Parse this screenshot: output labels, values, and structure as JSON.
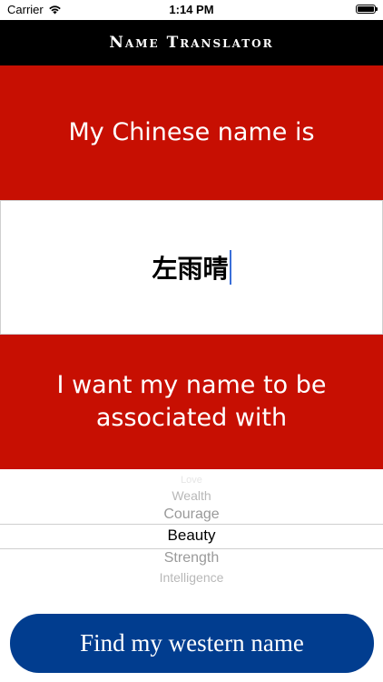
{
  "status_bar": {
    "carrier": "Carrier",
    "wifi_icon": "wifi-icon",
    "time": "1:14 PM",
    "battery_icon": "battery-icon",
    "battery_level": 1.0
  },
  "nav": {
    "title": "Name Translator"
  },
  "prompt_name": "My Chinese name is",
  "name_field": {
    "value": "左雨晴"
  },
  "prompt_association": "I want my name to be associated with",
  "picker": {
    "items": [
      "Love",
      "Wealth",
      "Courage",
      "Beauty",
      "Strength",
      "Intelligence"
    ],
    "selected": "Beauty"
  },
  "button": {
    "label": "Find my western name"
  },
  "colors": {
    "panel_red": "#c70f02",
    "nav_black": "#000000",
    "button_blue": "#013d8f",
    "cursor_blue": "#3a6fd8"
  }
}
